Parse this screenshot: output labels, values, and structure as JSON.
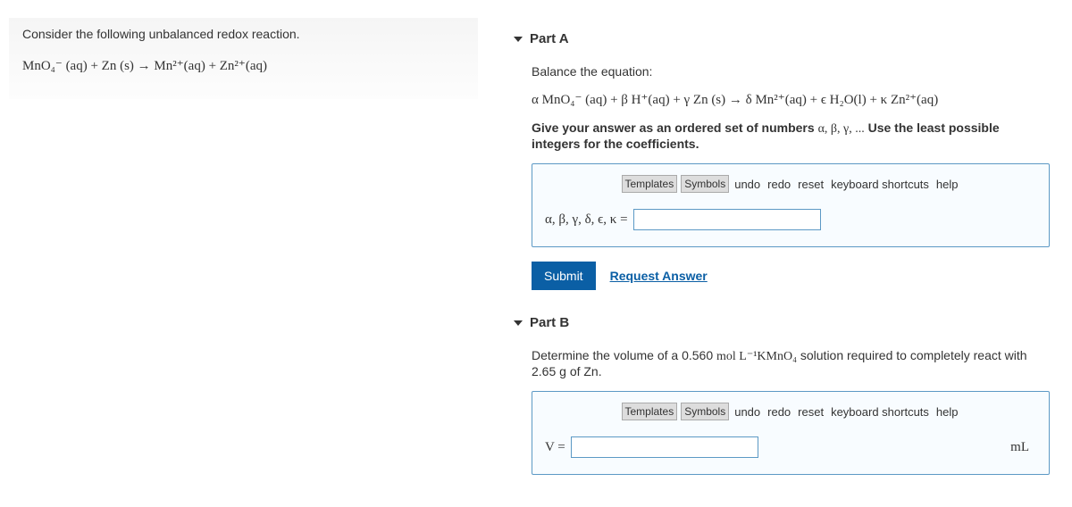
{
  "left": {
    "prompt": "Consider the following unbalanced redox reaction.",
    "equation": "MnO₄⁻ (aq) + Zn (s) → Mn²⁺(aq) + Zn²⁺(aq)"
  },
  "partA": {
    "title": "Part A",
    "instruction": "Balance the equation:",
    "balanced_eq": "α MnO₄⁻ (aq) + β H⁺(aq) + γ Zn (s) → δ Mn²⁺(aq) + ϵ H₂O(l) + κ Zn²⁺(aq)",
    "ordered_set_pre": "Give your answer as an ordered set of numbers ",
    "ordered_set_mid": "α, β, γ, ...",
    "ordered_set_post": " Use the least possible integers for the coefficients.",
    "toolbar": {
      "templates": "Templates",
      "symbols": "Symbols",
      "undo": "undo",
      "redo": "redo",
      "reset": "reset",
      "keyboard": "keyboard shortcuts",
      "help": "help"
    },
    "answer_label": "α, β, γ, δ, ϵ, κ =",
    "submit": "Submit",
    "request": "Request Answer"
  },
  "partB": {
    "title": "Part B",
    "question_pre": "Determine the volume of a 0.560 ",
    "question_unit": "mol L⁻¹KMnO₄",
    "question_post": " solution required to completely react with 2.65 g of Zn.",
    "toolbar": {
      "templates": "Templates",
      "symbols": "Symbols",
      "undo": "undo",
      "redo": "redo",
      "reset": "reset",
      "keyboard": "keyboard shortcuts",
      "help": "help"
    },
    "answer_label": "V =",
    "unit": "mL"
  }
}
